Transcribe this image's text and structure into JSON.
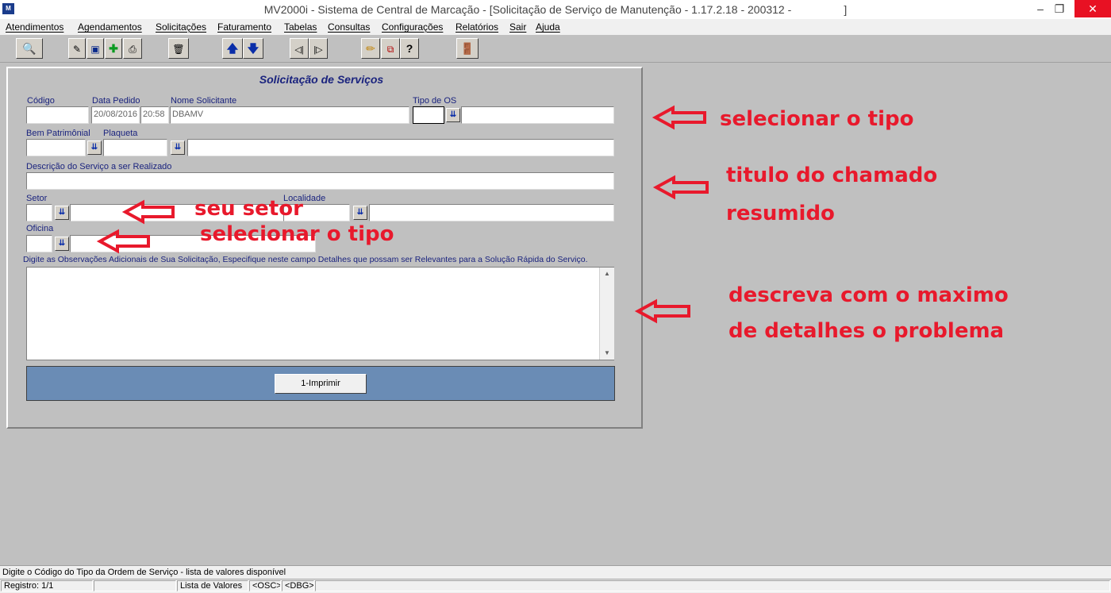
{
  "window": {
    "title": "MV2000i - Sistema de Central de Marcação - [Solicitação de Serviço de Manutenção - 1.17.2.18 - 200312 -",
    "title_end": "]",
    "minimize": "–",
    "maximize": "❐",
    "close": "✕"
  },
  "menu": [
    {
      "label": "Atendimentos"
    },
    {
      "label": "Agendamentos"
    },
    {
      "label": "Solicitações"
    },
    {
      "label": "Faturamento"
    },
    {
      "label": "Tabelas"
    },
    {
      "label": "Consultas"
    },
    {
      "label": "Configurações"
    },
    {
      "label": "Relatórios"
    },
    {
      "label": "Sair"
    },
    {
      "label": "Ajuda"
    }
  ],
  "toolbar": {
    "icons": [
      "query-icon",
      "edit-icon",
      "save-icon",
      "add-icon",
      "print-icon",
      "delete-icon",
      "arrow-up-icon",
      "arrow-down-icon",
      "first-icon",
      "last-icon",
      "pencil-icon",
      "copy-icon",
      "help-icon",
      "exit-icon"
    ]
  },
  "form": {
    "title": "Solicitação de Serviços",
    "labels": {
      "codigo": "Código",
      "data_pedido": "Data Pedido",
      "nome_solicitante": "Nome Solicitante",
      "tipo_os": "Tipo de OS",
      "bem_patrimonial": "Bem Patrimônial",
      "plaqueta": "Plaqueta",
      "descricao": "Descrição do Serviço a ser Realizado",
      "setor": "Setor",
      "localidade": "Localidade",
      "oficina": "Oficina",
      "observacoes": "Digite as Observações Adicionais de Sua Solicitação, Especifique neste campo Detalhes que possam ser Relevantes para a Solução Rápida do Serviço."
    },
    "values": {
      "data": "20/08/2016",
      "hora": "20:58",
      "nome": "DBAMV"
    },
    "lov_glyph": "⇊",
    "print_button": "1-Imprimir"
  },
  "annotations": {
    "tipo": "selecionar o tipo",
    "titulo_1": "titulo do chamado",
    "titulo_2": "resumido",
    "setor": "seu setor",
    "oficina": "selecionar o tipo",
    "descreva_1": "descreva com o maximo",
    "descreva_2": "de detalhes  o problema",
    "color": "#e8192c"
  },
  "status": {
    "message": "Digite o Código do Tipo da Ordem de Serviço - lista de valores disponível",
    "registro": "Registro: 1/1",
    "lista": "Lista de Valores",
    "osc": "<OSC>",
    "dbg": "<DBG>"
  }
}
